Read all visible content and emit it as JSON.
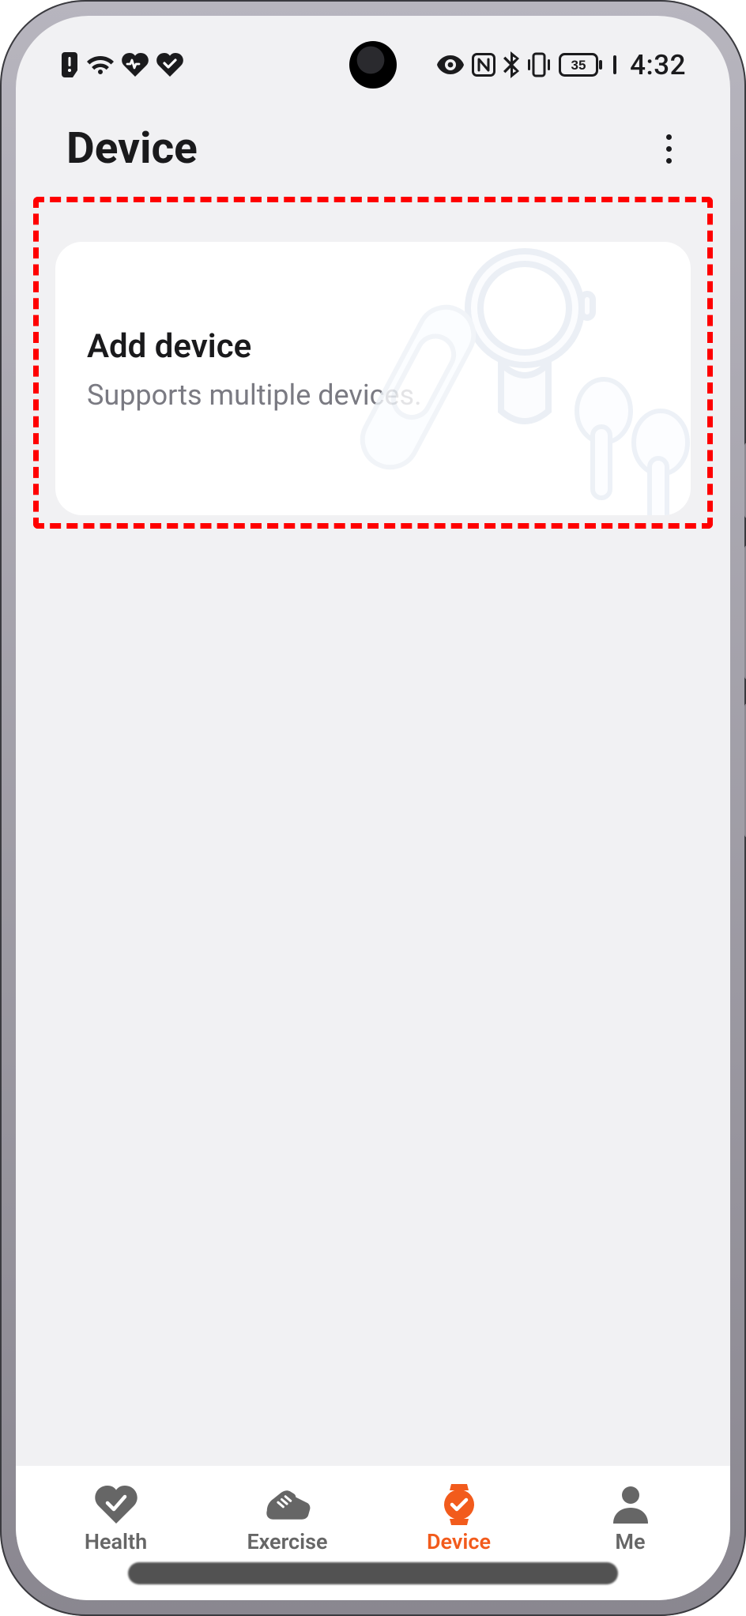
{
  "status_bar": {
    "battery_text": "35",
    "time": "4:32"
  },
  "header": {
    "title": "Device"
  },
  "card": {
    "title": "Add device",
    "subtitle": "Supports multiple devices."
  },
  "nav": {
    "items": [
      {
        "label": "Health",
        "active": false
      },
      {
        "label": "Exercise",
        "active": false
      },
      {
        "label": "Device",
        "active": true
      },
      {
        "label": "Me",
        "active": false
      }
    ]
  },
  "colors": {
    "accent": "#f25b1c",
    "highlight_border": "#ff0000"
  }
}
